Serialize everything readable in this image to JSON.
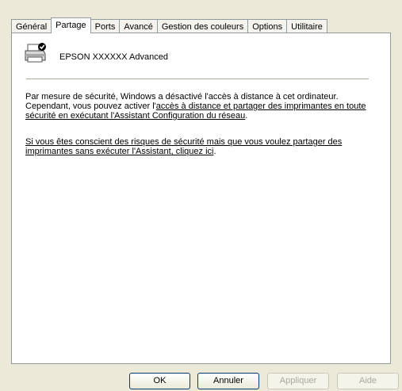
{
  "tabs": [
    {
      "label": "Général",
      "active": false
    },
    {
      "label": "Partage",
      "active": true
    },
    {
      "label": "Ports",
      "active": false
    },
    {
      "label": "Avancé",
      "active": false
    },
    {
      "label": "Gestion des couleurs",
      "active": false
    },
    {
      "label": "Options",
      "active": false
    },
    {
      "label": "Utilitaire",
      "active": false
    }
  ],
  "printer": {
    "icon": "shared-printer-icon",
    "name": "EPSON XXXXXX Advanced"
  },
  "message": {
    "p1_text": "Par mesure de sécurité, Windows a désactivé l'accès à distance à cet ordinateur. Cependant, vous pouvez activer l'",
    "p1_link1": "accès à distance et partager des imprimantes en toute sécurité en exécutant l'",
    "p1_link2": "Assistant Configuration du réseau",
    "p1_end": ".",
    "p2_link": "Si vous êtes conscient des risques de sécurité mais que vous voulez partager des imprimantes sans exécuter l'Assistant, cliquez ici",
    "p2_end": "."
  },
  "buttons": {
    "ok": "OK",
    "cancel": "Annuler",
    "apply": "Appliquer",
    "help": "Aide"
  }
}
